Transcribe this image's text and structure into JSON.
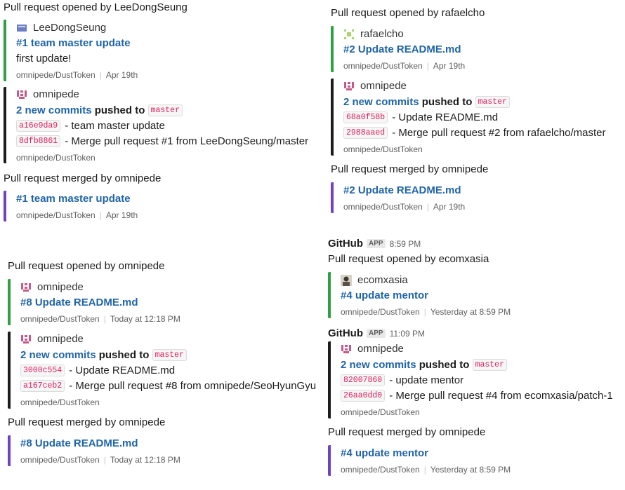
{
  "panel1": {
    "heading": "Pull request opened by LeeDongSeung",
    "opened": {
      "author": "LeeDongSeung",
      "author_icon": "user-avatar-icon",
      "title": "#1 team master update",
      "body": "first update!",
      "repo": "omnipede/DustToken",
      "date": "Apr 19th"
    },
    "push": {
      "author": "omnipede",
      "author_icon": "identicon-avatar-icon",
      "count_link": "2 new commits",
      "pushed_to": "pushed to",
      "branch": "master",
      "commits": [
        {
          "sha": "a16e9da9",
          "msg": "- team master update"
        },
        {
          "sha": "8dfb8861",
          "msg": "- Merge pull request #1 from LeeDongSeung/master"
        }
      ],
      "repo": "omnipede/DustToken"
    },
    "merged_heading": "Pull request merged by omnipede",
    "merged": {
      "title": "#1 team master update",
      "repo": "omnipede/DustToken",
      "date": "Apr 19th"
    }
  },
  "panel2": {
    "heading": "Pull request opened by rafaelcho",
    "opened": {
      "author": "rafaelcho",
      "author_icon": "identicon-avatar-icon",
      "title": "#2 Update README.md",
      "repo": "omnipede/DustToken",
      "date": "Apr 19th"
    },
    "push": {
      "author": "omnipede",
      "author_icon": "identicon-avatar-icon",
      "count_link": "2 new commits",
      "pushed_to": "pushed to",
      "branch": "master",
      "commits": [
        {
          "sha": "68a0f58b",
          "msg": "- Update README.md"
        },
        {
          "sha": "2988aaed",
          "msg": "- Merge pull request #2 from rafaelcho/master"
        }
      ],
      "repo": "omnipede/DustToken"
    },
    "merged_heading": "Pull request merged by omnipede",
    "merged": {
      "title": "#2 Update README.md",
      "repo": "omnipede/DustToken",
      "date": "Apr 19th"
    }
  },
  "panel3": {
    "heading": "Pull request opened by omnipede",
    "opened": {
      "author": "omnipede",
      "author_icon": "identicon-avatar-icon",
      "title": "#8 Update README.md",
      "repo": "omnipede/DustToken",
      "date": "Today at 12:18 PM"
    },
    "push": {
      "author": "omnipede",
      "author_icon": "identicon-avatar-icon",
      "count_link": "2 new commits",
      "pushed_to": "pushed to",
      "branch": "master",
      "commits": [
        {
          "sha": "3000c554",
          "msg": "- Update README.md"
        },
        {
          "sha": "a167ceb2",
          "msg": "- Merge pull request #8 from omnipede/SeoHyunGyu"
        }
      ],
      "repo": "omnipede/DustToken"
    },
    "merged_heading": "Pull request merged by omnipede",
    "merged": {
      "title": "#8 Update README.md",
      "repo": "omnipede/DustToken",
      "date": "Today at 12:18 PM"
    }
  },
  "panel4": {
    "msg1": {
      "sender": "GitHub",
      "badge": "APP",
      "time": "8:59 PM"
    },
    "heading": "Pull request opened by ecomxasia",
    "opened": {
      "author": "ecomxasia",
      "author_icon": "photo-avatar-icon",
      "title": "#4 update mentor",
      "repo": "omnipede/DustToken",
      "date": "Yesterday at 8:59 PM"
    },
    "msg2": {
      "sender": "GitHub",
      "badge": "APP",
      "time": "11:09 PM"
    },
    "push": {
      "author": "omnipede",
      "author_icon": "identicon-avatar-icon",
      "count_link": "2 new commits",
      "pushed_to": "pushed to",
      "branch": "master",
      "commits": [
        {
          "sha": "82007860",
          "msg": "- update mentor"
        },
        {
          "sha": "26aa0dd0",
          "msg": "- Merge pull request #4 from ecomxasia/patch-1"
        }
      ],
      "repo": "omnipede/DustToken"
    },
    "merged_heading": "Pull request merged by omnipede",
    "merged": {
      "title": "#4 update mentor",
      "repo": "omnipede/DustToken",
      "date": "Yesterday at 8:59 PM"
    }
  }
}
